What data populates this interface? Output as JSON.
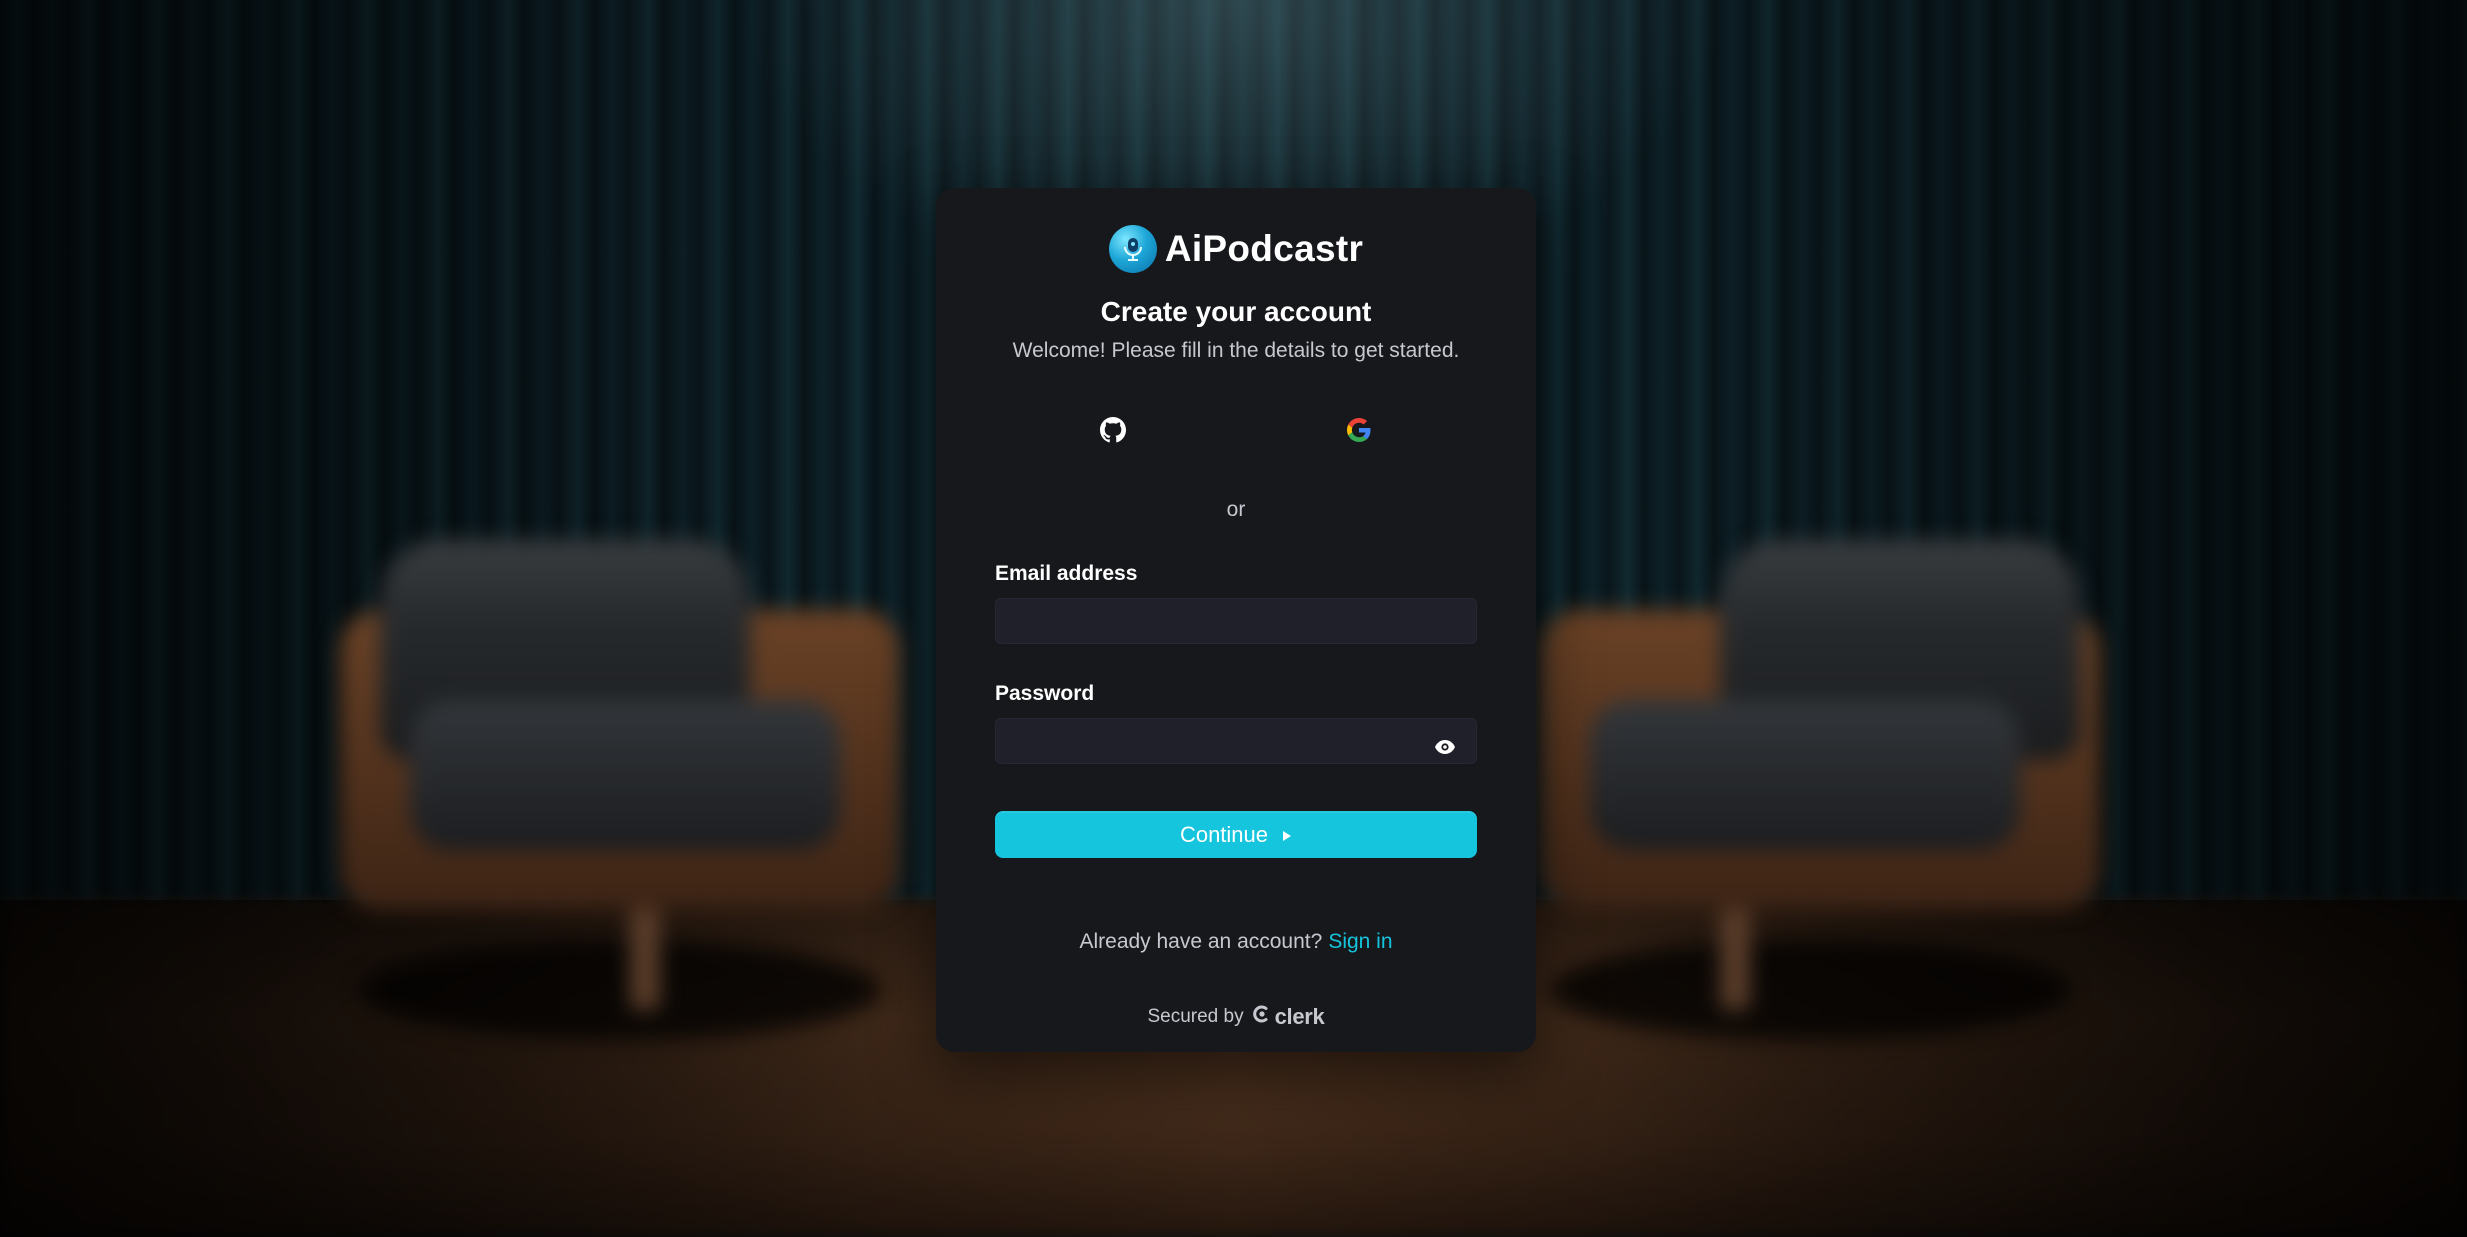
{
  "brand": {
    "name": "AiPodcastr"
  },
  "form": {
    "heading": "Create your account",
    "subheading": "Welcome! Please fill in the details to get started.",
    "social": [
      {
        "provider": "GitHub",
        "icon": "github-icon"
      },
      {
        "provider": "Google",
        "icon": "google-icon"
      }
    ],
    "divider": "or",
    "email_label": "Email address",
    "email_value": "",
    "password_label": "Password",
    "password_value": "",
    "continue_label": "Continue"
  },
  "footer": {
    "prompt": "Already have an account?",
    "sign_in_label": "Sign in",
    "secured_by": "Secured by",
    "provider_name": "clerk"
  },
  "colors": {
    "accent": "#15c5dd",
    "card": "#17181c",
    "input_bg": "#1f2029"
  }
}
